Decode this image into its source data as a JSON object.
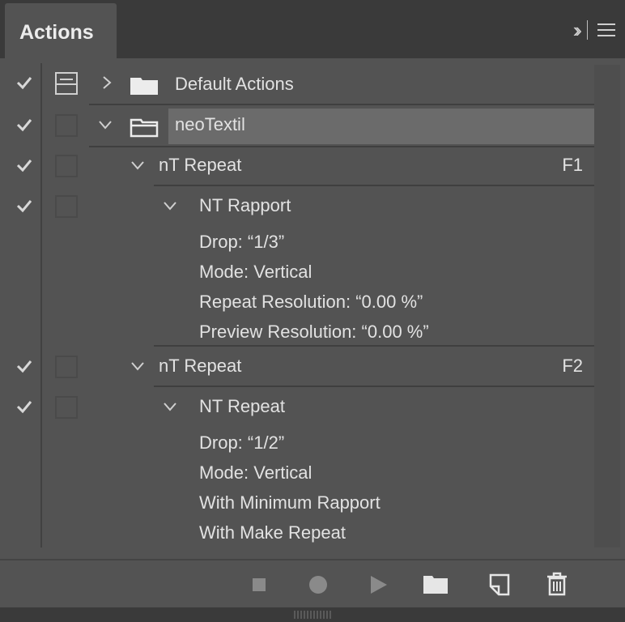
{
  "panel": {
    "tab_label": "Actions",
    "menu_icon": "panel-menu-icon",
    "collapse_icon": "double-chevron-right-icon"
  },
  "rows": [
    {
      "name": "Default Actions",
      "type": "set",
      "expanded": false
    },
    {
      "name": "neoTextil",
      "type": "set",
      "expanded": true,
      "selected": true
    },
    {
      "name": "nT Repeat",
      "type": "action",
      "key": "F1"
    },
    {
      "name": "NT Rapport",
      "type": "command"
    },
    {
      "name": "nT Repeat",
      "type": "action",
      "key": "F2"
    },
    {
      "name": "NT Repeat",
      "type": "command"
    }
  ],
  "details_rapport": [
    "Drop:  “1/3”",
    "Mode: Vertical",
    "Repeat Resolution:  “0.00 %”",
    "Preview Resolution:  “0.00 %”"
  ],
  "details_repeat": [
    "Drop:  “1/2”",
    "Mode: Vertical",
    "With Minimum Rapport",
    "With Make Repeat"
  ],
  "toolbar": {
    "icons": [
      "stop-icon",
      "record-icon",
      "play-icon",
      "new-set-folder-icon",
      "new-action-icon",
      "trash-icon"
    ]
  },
  "colors": {
    "panel": "#535353",
    "header": "#3a3a3a",
    "selected_row": "#6b6b6b"
  }
}
